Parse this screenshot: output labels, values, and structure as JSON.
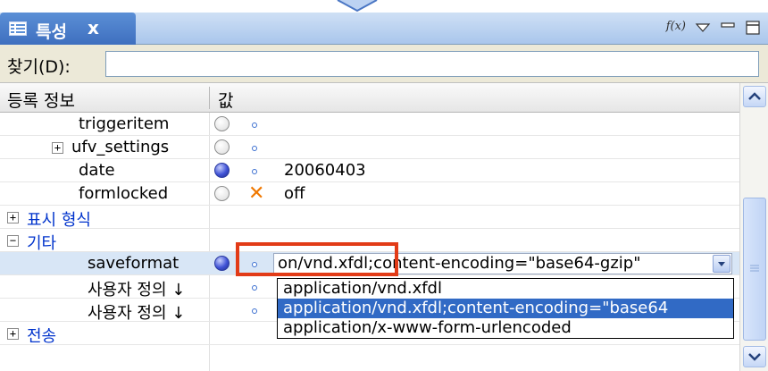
{
  "panel": {
    "tab_label": "특성",
    "tab_close": "x",
    "fx_label": "f(x)"
  },
  "search": {
    "label": "찾기(D):",
    "value": "",
    "placeholder": ""
  },
  "table": {
    "columns": [
      "등록 정보",
      "값"
    ]
  },
  "rows": [
    {
      "key": "triggeritem",
      "radio": "off",
      "value": ""
    },
    {
      "key": "ufv_settings",
      "radio": "off",
      "value": "",
      "expander": "+"
    },
    {
      "key": "date",
      "radio": "on",
      "value": "20060403"
    },
    {
      "key": "formlocked",
      "radio": "off",
      "value": "off",
      "marker": "✕"
    },
    {
      "key": "표시 형식",
      "expander": "+",
      "category": true
    },
    {
      "key": "기타",
      "expander": "−",
      "category": true
    },
    {
      "key": "saveformat",
      "radio": "on",
      "value": "on/vnd.xfdl;content-encoding=\"base64-gzip\""
    },
    {
      "key": "사용자 정의 ↓",
      "value": ""
    },
    {
      "key": "사용자 정의 ↓",
      "value": ""
    },
    {
      "key": "전송",
      "expander": "+",
      "category": true
    }
  ],
  "dropdown": {
    "options": [
      "application/vnd.xfdl",
      "application/vnd.xfdl;content-encoding=\"base64",
      "application/x-www-form-urlencoded"
    ],
    "selected_index": 1
  },
  "colors": {
    "selection": "#316ac5",
    "category_text": "#0033cc",
    "highlight_box": "#e23b17",
    "warning_marker": "#f07800"
  },
  "icons": [
    "properties-icon",
    "close-icon",
    "view-menu-icon",
    "minimize-icon",
    "maximize-icon",
    "scroll-up-icon",
    "scroll-down-icon",
    "combo-arrow-icon"
  ]
}
